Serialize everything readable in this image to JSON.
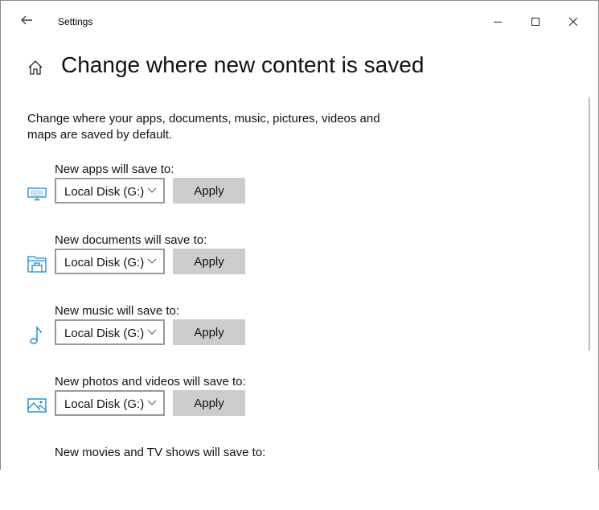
{
  "window": {
    "title": "Settings"
  },
  "page": {
    "title": "Change where new content is saved",
    "description": "Change where your apps, documents, music, pictures, videos and maps are saved by default."
  },
  "accent": "#0078d7",
  "sections": [
    {
      "label": "New apps will save to:",
      "value": "Local Disk (G:)",
      "apply": "Apply",
      "icon": "monitor-icon"
    },
    {
      "label": "New documents will save to:",
      "value": "Local Disk (G:)",
      "apply": "Apply",
      "icon": "folder-icon"
    },
    {
      "label": "New music will save to:",
      "value": "Local Disk (G:)",
      "apply": "Apply",
      "icon": "music-note-icon"
    },
    {
      "label": "New photos and videos will save to:",
      "value": "Local Disk (G:)",
      "apply": "Apply",
      "icon": "picture-icon"
    },
    {
      "label": "New movies and TV shows will save to:"
    }
  ]
}
